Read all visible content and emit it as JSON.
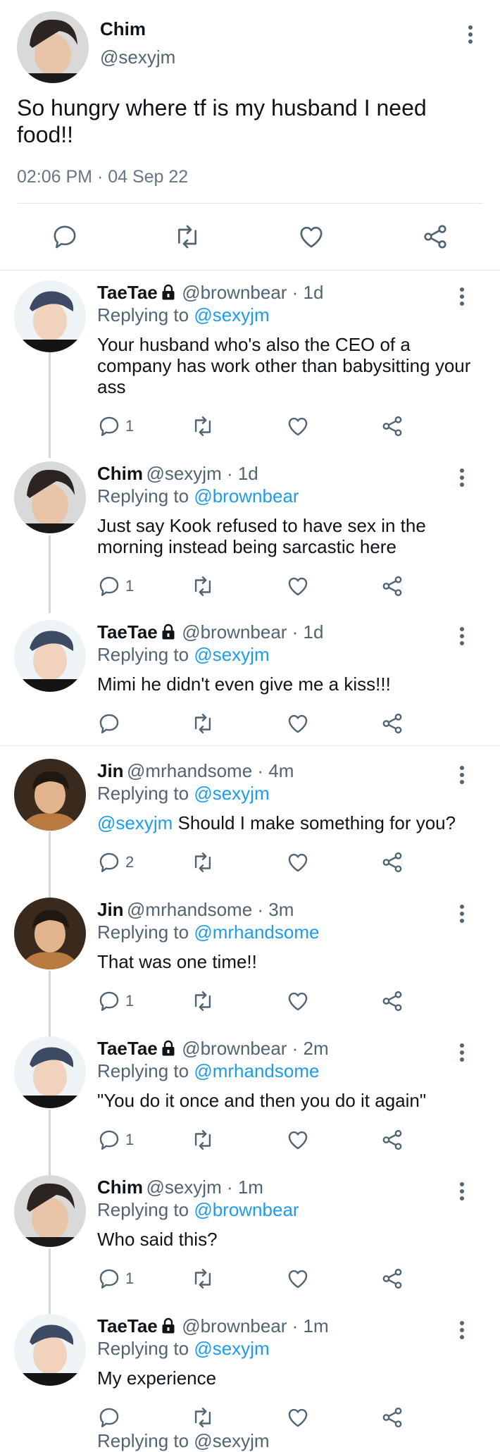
{
  "main_tweet": {
    "name": "Chim",
    "handle": "@sexyjm",
    "text_line1": "So hungry where tf is my husband I need",
    "text_line2": "food!!",
    "meta": "02:06 PM · 04 Sep 22"
  },
  "replies": [
    {
      "name": "TaeTae",
      "handle_time": "@brownbear · 1d",
      "replying_label": "Replying to",
      "replying_to": "@sexyjm",
      "lines": [
        "Your husband who's also the CEO of a",
        "company has work other than babysitting your",
        "ass"
      ],
      "reply_count": "1"
    },
    {
      "name": "Chim",
      "handle_time": "@sexyjm · 1d",
      "replying_label": "Replying to",
      "replying_to": "@brownbear",
      "lines": [
        "Just say Kook refused to have sex in the",
        "morning instead being sarcastic here"
      ],
      "reply_count": "1"
    },
    {
      "name": "TaeTae",
      "handle_time": "@brownbear · 1d",
      "replying_label": "Replying to",
      "replying_to": "@sexyjm",
      "lines": [
        "Mimi he didn't even give me a kiss!!!"
      ],
      "reply_count": ""
    },
    {
      "name": "Jin",
      "handle_time": "@mrhandsome · 4m",
      "replying_label": "Replying to",
      "replying_to": "@sexyjm",
      "mention": "@sexyjm",
      "lines": [
        "Should I make something for you?"
      ],
      "reply_count": "2"
    },
    {
      "name": "Jin",
      "handle_time": "@mrhandsome · 3m",
      "replying_label": "Replying to",
      "replying_to": "@mrhandsome",
      "lines": [
        "That was one time!!"
      ],
      "reply_count": "1"
    },
    {
      "name": "TaeTae",
      "handle_time": "@brownbear · 2m",
      "replying_label": "Replying to",
      "replying_to": "@mrhandsome",
      "lines": [
        "\"You do it once and then you do it again\""
      ],
      "reply_count": "1"
    },
    {
      "name": "Chim",
      "handle_time": "@sexyjm · 1m",
      "replying_label": "Replying to",
      "replying_to": "@brownbear",
      "lines": [
        "Who said this?"
      ],
      "reply_count": "1"
    },
    {
      "name": "TaeTae",
      "handle_time": "@brownbear · 1m",
      "replying_label": "Replying to",
      "replying_to": "@sexyjm",
      "lines": [
        "My experience"
      ],
      "reply_count": ""
    }
  ],
  "cutoff_text": "Replying to @sexyjm",
  "colors": {
    "accent": "#1d9bf0",
    "muted": "#536471",
    "divider": "#e1e8ed"
  },
  "icons": [
    "reply-icon",
    "retweet-icon",
    "like-icon",
    "share-icon",
    "more-icon",
    "lock-icon"
  ]
}
